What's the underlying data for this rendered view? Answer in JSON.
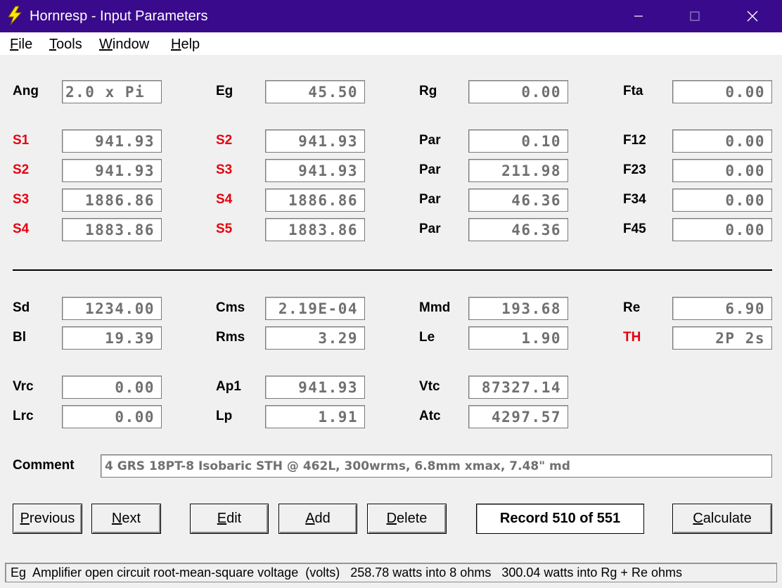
{
  "window": {
    "title": "Hornresp - Input Parameters",
    "icon": "lightning-bolt-icon",
    "controls": [
      "minimize-icon",
      "maximize-icon",
      "close-icon"
    ]
  },
  "menu": [
    {
      "key": "F",
      "rest": "ile"
    },
    {
      "key": "T",
      "rest": "ools"
    },
    {
      "key": "W",
      "rest": "indow"
    },
    {
      "key": "H",
      "rest": "elp"
    }
  ],
  "colors": {
    "titlebar": "#3a0a8c",
    "label_red": "#e8000e",
    "field_text": "#707070"
  },
  "params": {
    "ang": {
      "label": "Ang",
      "value": "2.0 x Pi"
    },
    "eg": {
      "label": "Eg",
      "value": "45.50"
    },
    "rg": {
      "label": "Rg",
      "value": "0.00"
    },
    "fta": {
      "label": "Fta",
      "value": "0.00"
    },
    "rows": [
      {
        "a_label": "S1",
        "a_value": "941.93",
        "b_label": "S2",
        "b_value": "941.93",
        "c_label": "Par",
        "c_value": "0.10",
        "d_label": "F12",
        "d_value": "0.00"
      },
      {
        "a_label": "S2",
        "a_value": "941.93",
        "b_label": "S3",
        "b_value": "941.93",
        "c_label": "Par",
        "c_value": "211.98",
        "d_label": "F23",
        "d_value": "0.00"
      },
      {
        "a_label": "S3",
        "a_value": "1886.86",
        "b_label": "S4",
        "b_value": "1886.86",
        "c_label": "Par",
        "c_value": "46.36",
        "d_label": "F34",
        "d_value": "0.00"
      },
      {
        "a_label": "S4",
        "a_value": "1883.86",
        "b_label": "S5",
        "b_value": "1883.86",
        "c_label": "Par",
        "c_value": "46.36",
        "d_label": "F45",
        "d_value": "0.00"
      }
    ]
  },
  "driver": {
    "sd": {
      "label": "Sd",
      "value": "1234.00"
    },
    "cms": {
      "label": "Cms",
      "value": "2.19E-04"
    },
    "mmd": {
      "label": "Mmd",
      "value": "193.68"
    },
    "re": {
      "label": "Re",
      "value": "6.90"
    },
    "bl": {
      "label": "Bl",
      "value": "19.39"
    },
    "rms": {
      "label": "Rms",
      "value": "3.29"
    },
    "le": {
      "label": "Le",
      "value": "1.90"
    },
    "th": {
      "label": "TH",
      "value": "2P 2s"
    }
  },
  "chamber": {
    "vrc": {
      "label": "Vrc",
      "value": "0.00"
    },
    "ap1": {
      "label": "Ap1",
      "value": "941.93"
    },
    "vtc": {
      "label": "Vtc",
      "value": "87327.14"
    },
    "lrc": {
      "label": "Lrc",
      "value": "0.00"
    },
    "lp": {
      "label": "Lp",
      "value": "1.91"
    },
    "atc": {
      "label": "Atc",
      "value": "4297.57"
    }
  },
  "comment": {
    "label": "Comment",
    "value": "4 GRS 18PT-8 Isobaric STH @ 462L, 300wrms, 6.8mm xmax, 7.48\" md"
  },
  "buttons": {
    "previous": {
      "key": "P",
      "rest": "revious"
    },
    "next": {
      "key": "N",
      "rest": "ext"
    },
    "edit": {
      "key": "E",
      "rest": "dit"
    },
    "add": {
      "key": "A",
      "rest": "dd"
    },
    "delete": {
      "key": "D",
      "rest": "elete"
    },
    "calculate": {
      "key": "C",
      "rest": "alculate"
    }
  },
  "record": "Record 510 of 551",
  "status": "Eg  Amplifier open circuit root-mean-square voltage  (volts)   258.78 watts into 8 ohms   300.04 watts into Rg + Re ohms"
}
